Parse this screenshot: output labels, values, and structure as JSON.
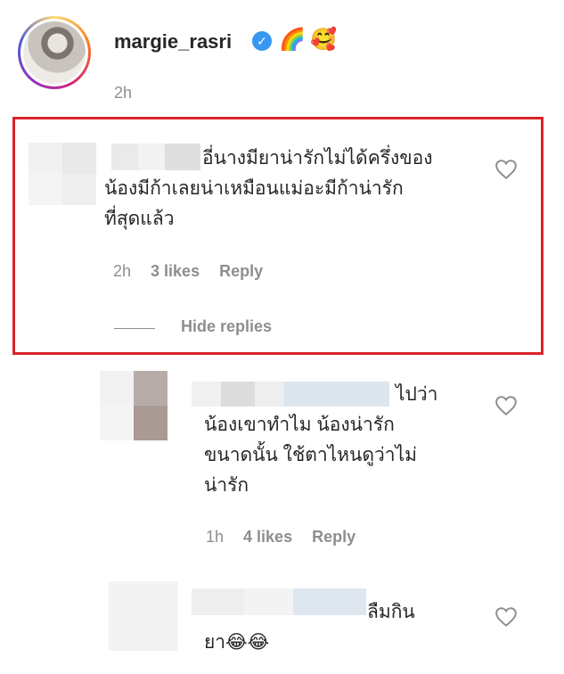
{
  "post": {
    "username": "margie_rasri",
    "verified_icon": "verified-badge-icon",
    "emojis": [
      "🌈",
      "🥰"
    ],
    "time": "2h"
  },
  "comments": [
    {
      "text_lines": [
        "อี่นางมียาน่ารักไม่ได้ครึ่งของ",
        "น้องมีก้าเลยน่าเหมือนแม่อะมีก้าน่ารัก",
        "ที่สุดแล้ว"
      ],
      "time": "2h",
      "likes": "3 likes",
      "reply": "Reply",
      "hide_replies": "Hide replies"
    },
    {
      "text_lines": [
        "ไปว่า",
        "น้องเขาทำไม น้องน่ารัก",
        "ขนาดนั้น ใช้ตาไหนดูว่าไม่",
        "น่ารัก"
      ],
      "time": "1h",
      "likes": "4 likes",
      "reply": "Reply"
    },
    {
      "text_lines": [
        "ลืมกิน",
        "ยา😂😂"
      ]
    }
  ],
  "colors": {
    "highlight_border": "#d8232a",
    "verified": "#3897f0",
    "muted_text": "#8e8e8e"
  }
}
